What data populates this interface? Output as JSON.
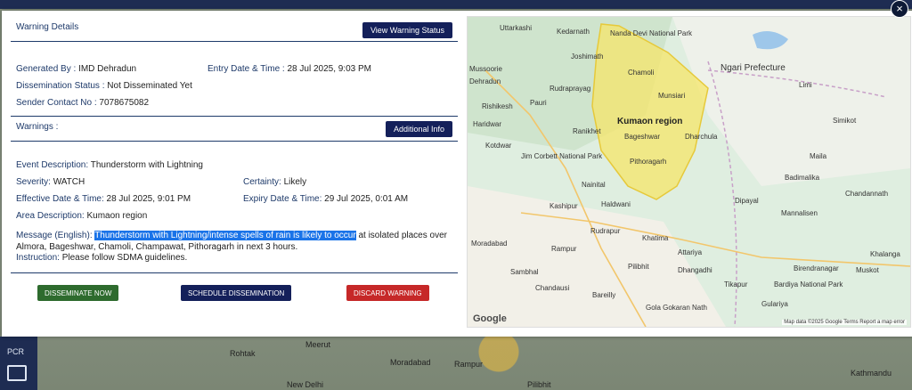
{
  "background": {
    "sidebar_label": "PCR",
    "map_labels": [
      "Rohtak",
      "Meerut",
      "New Delhi",
      "Moradabad",
      "Rampur",
      "Pilibhit",
      "Kathmandu"
    ]
  },
  "close_symbol": "×",
  "details": {
    "title": "Warning Details",
    "view_status_button": "View Warning Status",
    "generated_by_label": "Generated By :",
    "generated_by": "IMD Dehradun",
    "entry_date_label": "Entry Date & Time :",
    "entry_date": "28 Jul 2025, 9:03 PM",
    "dissemination_status_label": "Dissemination Status :",
    "dissemination_status": "Not Disseminated Yet",
    "sender_contact_label": "Sender Contact No :",
    "sender_contact": "7078675082"
  },
  "warnings": {
    "title": "Warnings :",
    "additional_info_button": "Additional Info",
    "event_label": "Event Description:",
    "event": "Thunderstorm with Lightning",
    "severity_label": "Severity:",
    "severity": "WATCH",
    "certainty_label": "Certainty:",
    "certainty": "Likely",
    "effective_label": "Effective Date & Time:",
    "effective": "28 Jul 2025, 9:01 PM",
    "expiry_label": "Expiry Date & Time:",
    "expiry": "29 Jul 2025, 0:01 AM",
    "area_label": "Area Description:",
    "area": "Kumaon region",
    "message_label": "Message (English):",
    "message_highlighted": "Thunderstorm with Lightning/intense spells of rain is likely to occur",
    "message_rest": " at isolated places over Almora, Bageshwar, Chamoli, Champawat, Pithoragarh in next 3 hours.",
    "instruction_label": "Instruction:",
    "instruction": "Please follow SDMA guidelines."
  },
  "actions": {
    "disseminate": "DISSEMINATE NOW",
    "schedule": "SCHEDULE DISSEMINATION",
    "discard": "DISCARD WARNING"
  },
  "colors": {
    "navy": "#14205a",
    "green": "#2e6b2e",
    "red": "#c62828",
    "highlight": "#1a73e8",
    "region_fill": "#f5e66a"
  },
  "map": {
    "region_label": "Kumaon region",
    "places": [
      "Uttarkashi",
      "Kedarnath",
      "Nanda Devi National Park",
      "Joshimath",
      "Chamoli",
      "Mussoorie",
      "Dehradun",
      "Rudraprayag",
      "Pauri",
      "Rishikesh",
      "Haridwar",
      "Kotdwar",
      "Jim Corbett National Park",
      "Ranikhet",
      "Munsiari",
      "Bageshwar",
      "Dharchula",
      "Pithoragarh",
      "Nainital",
      "Haldwani",
      "Kashipur",
      "Rudrapur",
      "Moradabad",
      "Rampur",
      "Bareilly",
      "Pilibhit",
      "Sambhal",
      "Chandausi",
      "Khatima",
      "Attariya",
      "Dhangadhi",
      "Tikapur",
      "Gola Gokaran Nath",
      "Ngari Prefecture",
      "Simikot",
      "Limi",
      "Maila",
      "Badimalika",
      "Dipayal",
      "Mannalisen",
      "Chandannath",
      "Khalanga",
      "Birendranagar",
      "Bardiya National Park",
      "Gulariya",
      "Muskot"
    ],
    "logo": "Google",
    "attribution": "Map data ©2025 Google   Terms   Report a map error"
  }
}
